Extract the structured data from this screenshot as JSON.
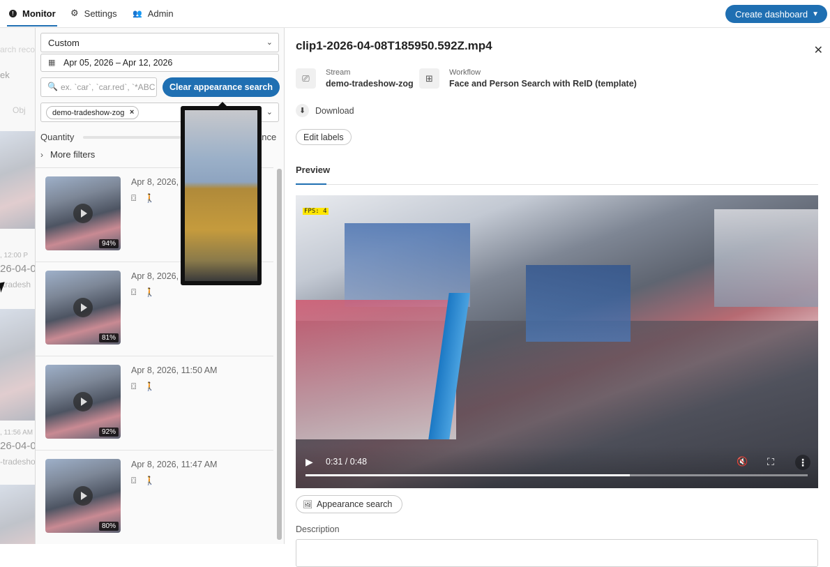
{
  "nav": {
    "monitor": "Monitor",
    "settings": "Settings",
    "admin": "Admin",
    "create_dashboard": "Create dashboard"
  },
  "background_list": {
    "search_placeholder": "arch recor",
    "period": "ek",
    "objects_label": "Obj",
    "entries": [
      {
        "time": ", 12:00 P",
        "date": "26-04-0",
        "stream": "-tradesh"
      },
      {
        "time": ", 11:56 AM",
        "date": "26-04-0",
        "stream": "-tradesho"
      }
    ]
  },
  "filters": {
    "range_select": "Custom",
    "date_range": "Apr 05, 2026 – Apr 12, 2026",
    "search_placeholder": "ex. `car`, `car.red`, `*ABC",
    "clear_button": "Clear appearance search",
    "stream_chip": "demo-tradeshow-zog",
    "quantity_label": "Quantity",
    "quantity_right": "ance",
    "more_filters": "More filters"
  },
  "results": [
    {
      "time": "Apr 8, 2026, 1",
      "confidence": "94%"
    },
    {
      "time": "Apr 8, 2026, 1",
      "confidence": "81%"
    },
    {
      "time": "Apr 8, 2026, 11:50 AM",
      "confidence": "92%"
    },
    {
      "time": "Apr 8, 2026, 11:47 AM",
      "confidence": "80%"
    }
  ],
  "detail": {
    "title": "clip1-2026-04-08T185950.592Z.mp4",
    "stream_label": "Stream",
    "stream_value": "demo-tradeshow-zog",
    "workflow_label": "Workflow",
    "workflow_value": "Face and Person Search with ReID (template)",
    "download": "Download",
    "edit_labels": "Edit labels",
    "tab_preview": "Preview",
    "fps_badge": "FPS: 4",
    "video_time": "0:31 / 0:48",
    "video_progress": 0.646,
    "appearance_search": "Appearance search",
    "description_label": "Description"
  },
  "colors": {
    "accent": "#1f6fb2"
  }
}
